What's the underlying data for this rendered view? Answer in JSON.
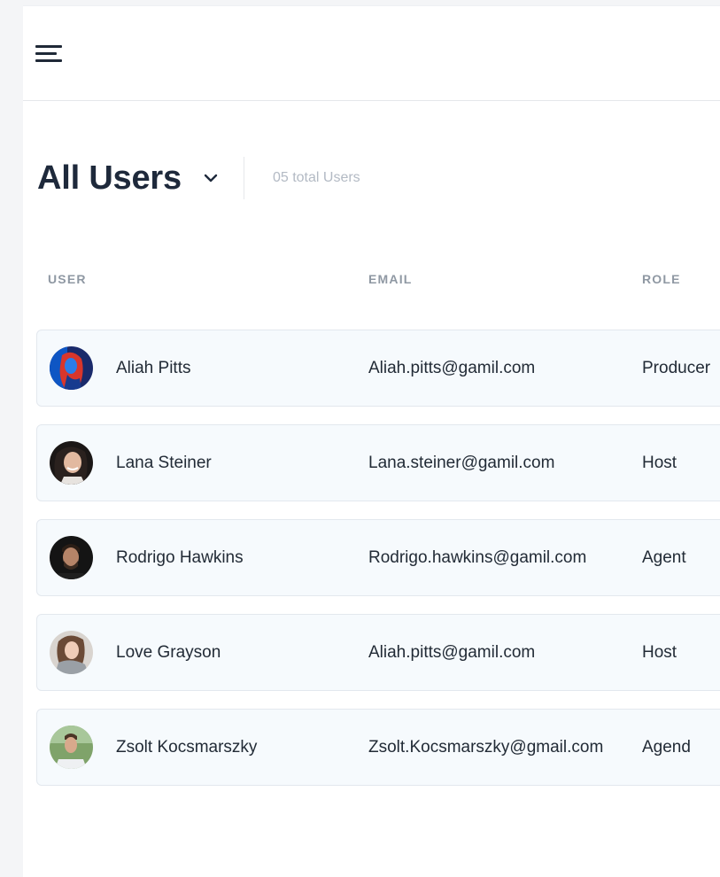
{
  "header": {
    "menu_icon": "hamburger-menu-icon"
  },
  "page": {
    "title": "All Users",
    "dropdown_icon": "chevron-down-icon",
    "total_label": "05 total Users"
  },
  "table": {
    "columns": [
      "USER",
      "EMAIL",
      "ROLE"
    ],
    "rows": [
      {
        "name": "Aliah Pitts",
        "email": "Aliah.pitts@gamil.com",
        "role": "Producer"
      },
      {
        "name": "Lana Steiner",
        "email": "Lana.steiner@gamil.com",
        "role": "Host"
      },
      {
        "name": "Rodrigo Hawkins",
        "email": "Rodrigo.hawkins@gamil.com",
        "role": "Agent"
      },
      {
        "name": "Love Grayson",
        "email": "Aliah.pitts@gamil.com",
        "role": "Host"
      },
      {
        "name": "Zsolt Kocsmarszky",
        "email": "Zsolt.Kocsmarszky@gmail.com",
        "role": "Agend"
      }
    ]
  },
  "colors": {
    "title": "#1e293b",
    "row_background": "#f6fafd",
    "row_border": "#e3e8ee",
    "muted_text": "#b3bac4"
  }
}
